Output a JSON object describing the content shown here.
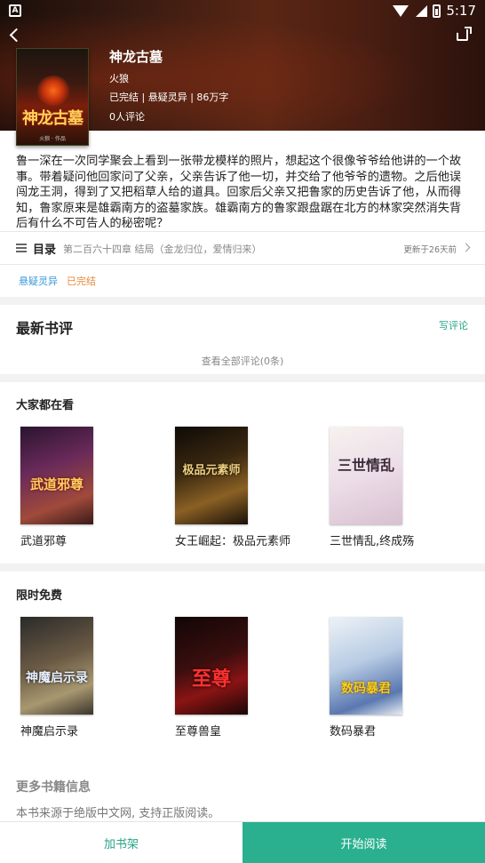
{
  "status_bar": {
    "time": "5:17",
    "left_icon_glyph": "A",
    "icons": [
      "wifi-icon",
      "signal-icon",
      "battery-icon"
    ]
  },
  "header": {
    "back_icon": "chevron-left-icon",
    "share_icon": "share-icon"
  },
  "book": {
    "title": "神龙古墓",
    "author": "火狼",
    "meta": "已完结 | 悬疑灵异 | 86万字",
    "reviews": "0人评论",
    "cover_text": "神龙古墓",
    "cover_author": "火狼 · 作品",
    "description": "鲁一深在一次同学聚会上看到一张带龙模样的照片，想起这个很像爷爷给他讲的一个故事。带着疑问他回家问了父亲，父亲告诉了他一切，并交给了他爷爷的遗物。之后他误闯龙王洞，得到了又把稻草人给的道具。回家后父亲又把鲁家的历史告诉了他，从而得知，鲁家原来是雄霸南方的盗墓家族。雄霸南方的鲁家跟盘踞在北方的林家突然消失背后有什么不可告人的秘密呢？"
  },
  "toc": {
    "label": "目录",
    "latest_chapter": "第二百六十四章 结局（金龙归位，爱情归来）",
    "updated": "更新于26天前"
  },
  "tags": {
    "genre": "悬疑灵异",
    "status": "已完结"
  },
  "reviews_section": {
    "title": "最新书评",
    "write_label": "写评论",
    "view_all": "查看全部评论(0条)"
  },
  "popular": {
    "title": "大家都在看",
    "books": [
      {
        "name": "武道邪尊",
        "cover_text": "武道邪尊",
        "colors": [
          "#3a1e3a",
          "#7a3a6a",
          "#c05a30"
        ]
      },
      {
        "name": "女王崛起：极品元素师",
        "cover_text": "极品元素师",
        "colors": [
          "#1a1208",
          "#6a4a20",
          "#d8a040"
        ]
      },
      {
        "name": "三世情乱,终成殇",
        "cover_text": "三世情乱",
        "colors": [
          "#f4eee8",
          "#e8d8e4",
          "#c0a0b8"
        ]
      }
    ]
  },
  "free": {
    "title": "限时免费",
    "books": [
      {
        "name": "神魔启示录",
        "cover_text": "神魔启示录",
        "colors": [
          "#3a3a3a",
          "#7a6a50",
          "#b8a878"
        ]
      },
      {
        "name": "至尊兽皇",
        "cover_text": "至尊",
        "colors": [
          "#1a0a0a",
          "#5a1010",
          "#c02020"
        ]
      },
      {
        "name": "数码暴君",
        "cover_text": "数码暴君",
        "colors": [
          "#e8eef4",
          "#a8c0dc",
          "#3a5a9a"
        ]
      }
    ]
  },
  "more_info": {
    "title": "更多书籍信息",
    "text": "本书来源于绝版中文网, 支持正版阅读。"
  },
  "bottom_bar": {
    "add_shelf": "加书架",
    "start_reading": "开始阅读"
  },
  "colors": {
    "accent": "#2ab08f",
    "genre_tag": "#3a9ad9",
    "status_tag": "#e8883a"
  }
}
